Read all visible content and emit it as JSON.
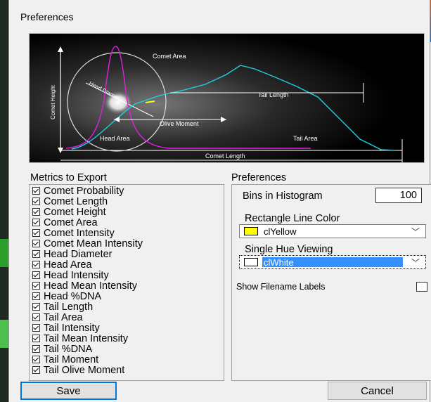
{
  "dialog": {
    "title": "Preferences"
  },
  "diagram": {
    "labels": {
      "comet_area": "Comet Area",
      "head_diameter": "Head Diameter",
      "tail_length": "Tail Length",
      "comet_height": "Comet Height",
      "olive_moment": "Olive Moment",
      "head_area": "Head Area",
      "tail_area": "Tail Area",
      "comet_length": "Comet Length"
    }
  },
  "metrics": {
    "heading": "Metrics to Export",
    "items": [
      {
        "label": "Comet Probability",
        "checked": true
      },
      {
        "label": "Comet Length",
        "checked": true
      },
      {
        "label": "Comet Height",
        "checked": true
      },
      {
        "label": "Comet Area",
        "checked": true
      },
      {
        "label": "Comet Intensity",
        "checked": true
      },
      {
        "label": "Comet Mean Intensity",
        "checked": true
      },
      {
        "label": "Head Diameter",
        "checked": true
      },
      {
        "label": "Head Area",
        "checked": true
      },
      {
        "label": "Head Intensity",
        "checked": true
      },
      {
        "label": "Head Mean Intensity",
        "checked": true
      },
      {
        "label": "Head %DNA",
        "checked": true
      },
      {
        "label": "Tail Length",
        "checked": true
      },
      {
        "label": "Tail Area",
        "checked": true
      },
      {
        "label": "Tail Intensity",
        "checked": true
      },
      {
        "label": "Tail Mean Intensity",
        "checked": true
      },
      {
        "label": "Tail %DNA",
        "checked": true
      },
      {
        "label": "Tail Moment",
        "checked": true
      },
      {
        "label": "Tail Olive Moment",
        "checked": true
      }
    ]
  },
  "preferences": {
    "heading": "Preferences",
    "bins_label": "Bins in Histogram",
    "bins_value": "100",
    "rect_color_label": "Rectangle Line Color",
    "rect_color_value": "clYellow",
    "rect_color_swatch": "#ffff00",
    "hue_label": "Single Hue Viewing",
    "hue_value": "clWhite",
    "hue_swatch": "#ffffff",
    "filename_label": "Show Filename Labels",
    "filename_checked": false
  },
  "buttons": {
    "save": "Save",
    "cancel": "Cancel"
  },
  "colors": {
    "accent": "#0078d7",
    "selection": "#3390ff"
  }
}
